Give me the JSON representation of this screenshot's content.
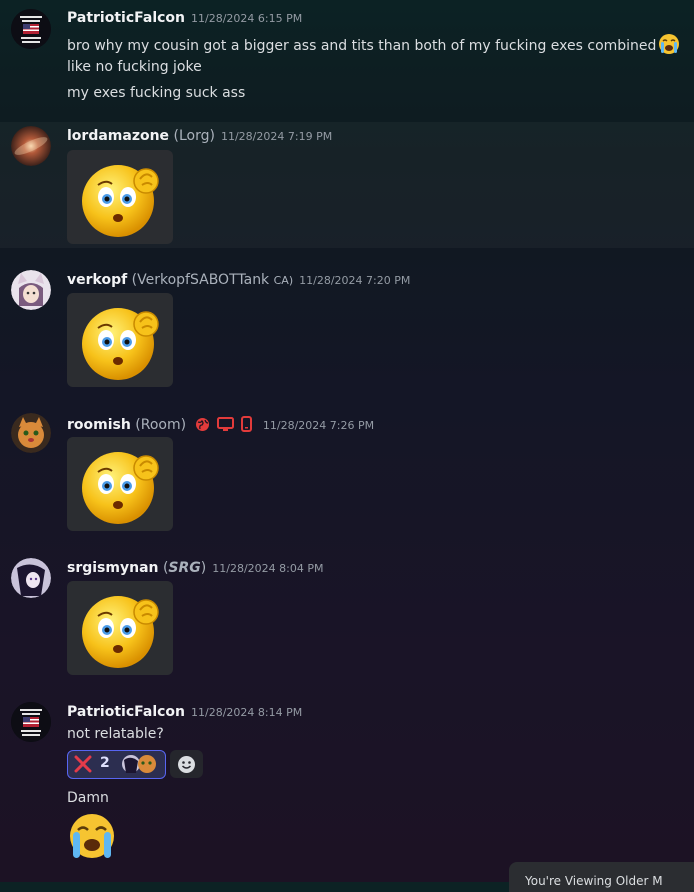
{
  "messages": [
    {
      "username": "PatrioticFalcon",
      "timestamp": "11/28/2024 6:15 PM",
      "lines": [
        "bro why my cousin got a bigger ass and tits than both of my fucking exes combined",
        "like no fucking joke",
        "my exes fucking suck ass"
      ],
      "inline_emoji": "loudly-crying-emoji"
    },
    {
      "username": "lordamazone",
      "alias": "(Lorg)",
      "timestamp": "11/28/2024 7:19 PM",
      "sticker": "confused-thinking-emoji-sticker"
    },
    {
      "username": "verkopf",
      "alias": "(VerkopfSABOTTank",
      "alias_tag": "CA)",
      "timestamp": "11/28/2024 7:20 PM",
      "sticker": "confused-thinking-emoji-sticker"
    },
    {
      "username": "roomish",
      "alias": "(Room)",
      "badge_icons": [
        "globe-icon",
        "desktop-icon",
        "mobile-icon"
      ],
      "timestamp": "11/28/2024 7:26 PM",
      "sticker": "confused-thinking-emoji-sticker"
    },
    {
      "username": "srgismynan",
      "alias_open": "(",
      "alias_tag": "SRG",
      "alias_close": ")",
      "timestamp": "11/28/2024 8:04 PM",
      "sticker": "confused-thinking-emoji-sticker"
    },
    {
      "username": "PatrioticFalcon",
      "timestamp": "11/28/2024 8:14 PM",
      "lines": [
        "not relatable?"
      ],
      "reaction": {
        "emoji": "cross-mark-icon",
        "count": "2"
      },
      "line2": "Damn",
      "big_emoji": "loudly-crying-emoji"
    }
  ],
  "toast": {
    "text": "You're Viewing Older M"
  },
  "colors": {
    "accent": "#5865f2",
    "badge_red": "#e23b3b",
    "reaction_bg": "#2c2e50"
  }
}
